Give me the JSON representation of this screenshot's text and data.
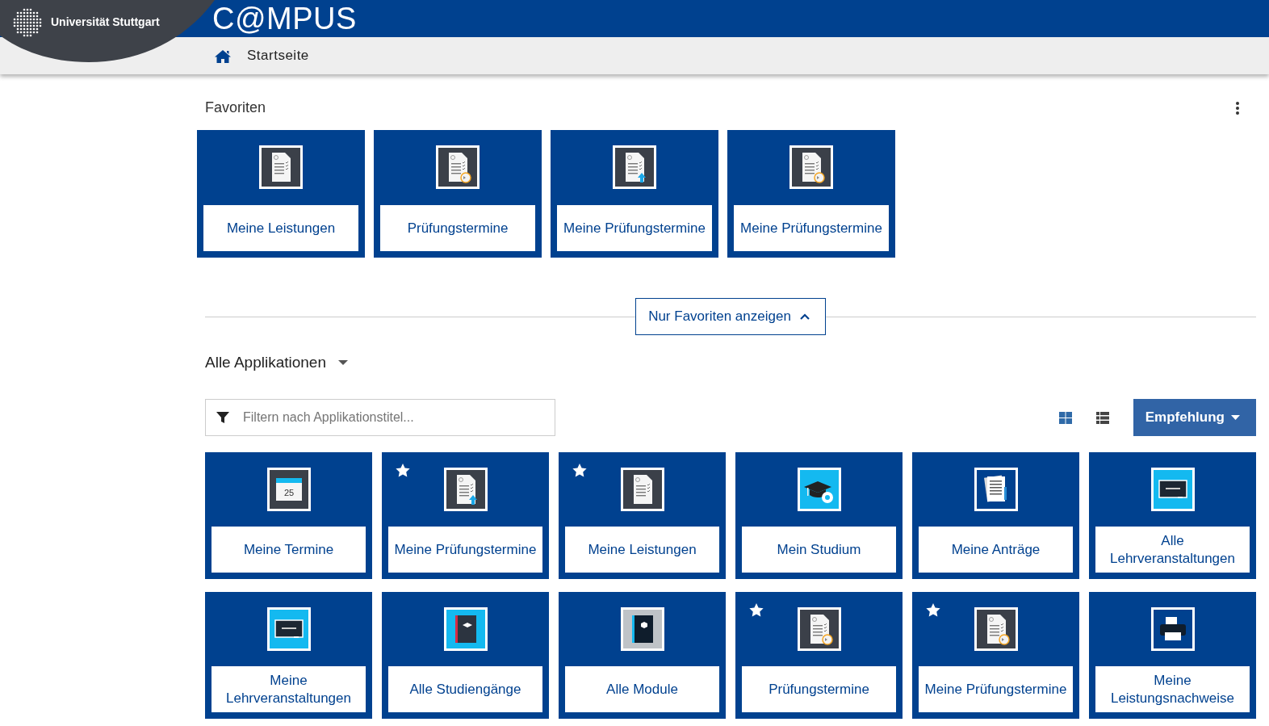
{
  "header": {
    "university": "Universität Stuttgart",
    "title": "C@MPUS",
    "breadcrumb": "Startseite"
  },
  "favorites": {
    "title": "Favoriten",
    "tiles": [
      {
        "kind": "doc",
        "label": "Meine Leistungen"
      },
      {
        "kind": "doc-clock",
        "label": "Prüfungstermine"
      },
      {
        "kind": "doc-upload",
        "label": "Meine Prüfungstermine"
      },
      {
        "kind": "doc-clock",
        "label": "Meine Prüfungstermine"
      }
    ]
  },
  "toggle_button": "Nur Favoriten anzeigen",
  "apps": {
    "title": "Alle Applikationen",
    "filter_placeholder": "Filtern nach Applikationstitel...",
    "views": [
      {
        "kind": "grid",
        "selected": true
      },
      {
        "kind": "list",
        "selected": false
      }
    ],
    "sort_button": "Empfehlung",
    "tiles": [
      {
        "kind": "calendar",
        "icon_text": "25",
        "label": "Meine Termine",
        "favorite": false
      },
      {
        "kind": "doc-upload",
        "label": "Meine Prüfungstermine",
        "favorite": true
      },
      {
        "kind": "doc",
        "label": "Meine Leistungen",
        "favorite": true
      },
      {
        "kind": "cap-gear",
        "label": "Mein Studium",
        "favorite": false
      },
      {
        "kind": "papers",
        "label": "Meine Anträge",
        "favorite": false
      },
      {
        "kind": "board",
        "label": "Alle Lehrveranstaltungen",
        "favorite": false
      },
      {
        "kind": "board",
        "label": "Meine Lehrveranstaltungen",
        "favorite": false
      },
      {
        "kind": "book-cap",
        "label": "Alle Studiengänge",
        "favorite": false
      },
      {
        "kind": "book-cube",
        "label": "Alle Module",
        "favorite": false
      },
      {
        "kind": "doc-clock",
        "label": "Prüfungstermine",
        "favorite": true
      },
      {
        "kind": "doc-clock",
        "label": "Meine Prüfungstermine",
        "favorite": true
      },
      {
        "kind": "printer",
        "label": "Meine Leistungsnachweise",
        "favorite": false
      }
    ]
  }
}
